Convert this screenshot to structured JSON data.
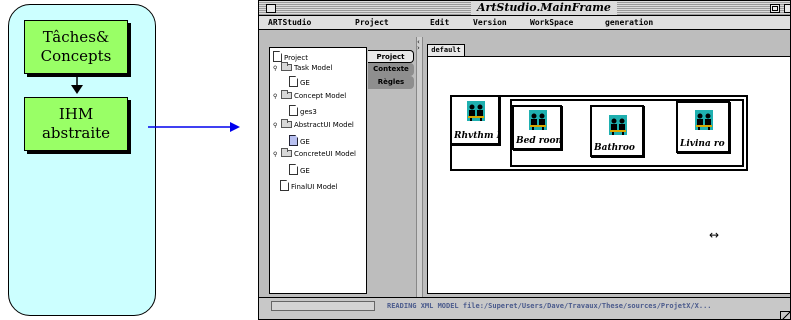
{
  "diagram": {
    "box_top": [
      "Tâches&",
      "Concepts"
    ],
    "box_bottom": [
      "IHM",
      "abstraite"
    ]
  },
  "window": {
    "title": "ArtStudio.MainFrame"
  },
  "menu": {
    "items": [
      "ARTStudio",
      "Project",
      "Edit",
      "Version",
      "WorkSpace",
      "generation"
    ]
  },
  "tree": {
    "nodes": [
      {
        "label": "Project",
        "icon": "folder-icon",
        "twisty": ""
      },
      {
        "label": "Task Model",
        "icon": "folder-icon",
        "twisty": "expanded"
      },
      {
        "label": "GE",
        "icon": "document-icon",
        "twisty": ""
      },
      {
        "label": "Concept Model",
        "icon": "folder-icon",
        "twisty": "expanded"
      },
      {
        "label": "ges3",
        "icon": "document-icon",
        "twisty": ""
      },
      {
        "label": "AbstractUI Model",
        "icon": "folder-icon",
        "twisty": "expanded"
      },
      {
        "label": "GE",
        "icon": "document-icon",
        "twisty": "",
        "selected": true
      },
      {
        "label": "ConcreteUI Model",
        "icon": "folder-icon",
        "twisty": "expanded"
      },
      {
        "label": "GE",
        "icon": "document-icon",
        "twisty": ""
      },
      {
        "label": "FinalUI Model",
        "icon": "document-icon",
        "twisty": ""
      }
    ]
  },
  "side_tabs": [
    {
      "label": "Project",
      "active": true
    },
    {
      "label": "Contexte",
      "active": false
    },
    {
      "label": "Règles",
      "active": false
    }
  ],
  "canvas": {
    "tab_label": "default",
    "cards": [
      {
        "label": "Rhvthm I"
      },
      {
        "label": "Bed roon"
      },
      {
        "label": "Bathroo"
      },
      {
        "label": "Livina ro"
      }
    ]
  },
  "status": {
    "message": "READING XML MODEL file:/Superet/Users/Dave/Travaux/These/sources/ProjetX/X..."
  },
  "colors": {
    "diagram_panel": "#ccffff",
    "diagram_box": "#99ff66",
    "arrow": "#0000ee",
    "icon_teal": "#1fb0b0"
  }
}
